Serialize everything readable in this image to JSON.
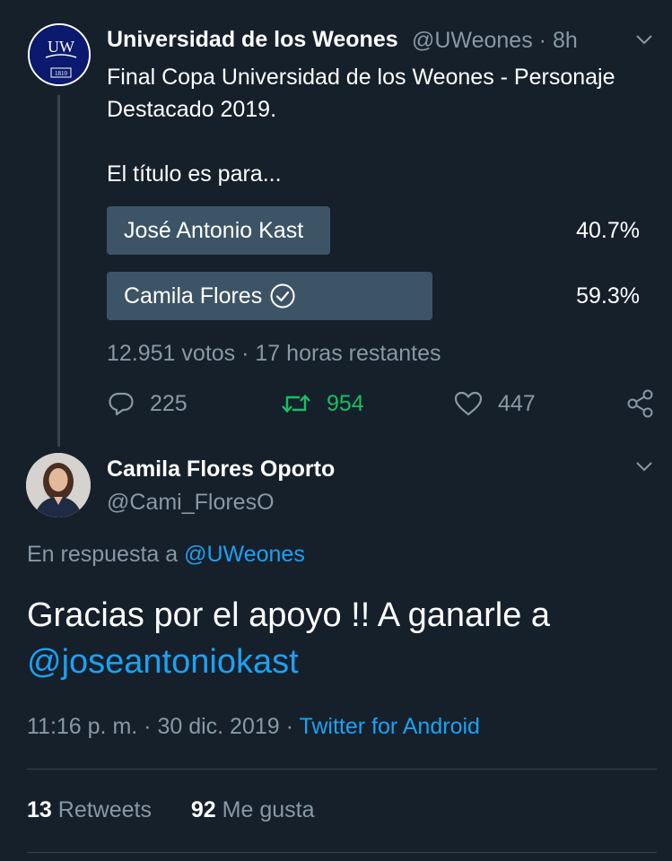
{
  "tweet1": {
    "avatar_text": "UW",
    "avatar_year": "1810",
    "name": "Universidad de los Weones",
    "handle": "@UWeones",
    "separator": "·",
    "time": "8h",
    "text_line1": "Final Copa Universidad de los Weones - Personaje Destacado 2019.",
    "text_line2": "El título es para...",
    "poll": {
      "options": [
        {
          "label": "José Antonio Kast",
          "percent": "40.7%",
          "fraction": 0.407,
          "winner": false
        },
        {
          "label": "Camila Flores",
          "percent": "59.3%",
          "fraction": 0.593,
          "winner": true
        }
      ],
      "votes": "12.951 votos",
      "remaining": "17 horas restantes"
    },
    "actions": {
      "reply_count": "225",
      "retweet_count": "954",
      "like_count": "447"
    }
  },
  "tweet2": {
    "name": "Camila Flores Oporto",
    "handle": "@Cami_FloresO",
    "reply_prefix": "En respuesta a",
    "reply_handle": "@UWeones",
    "text": "Gracias por el apoyo !! A ganarle a",
    "mention": "@joseantoniokast",
    "time": "11:16 p. m.",
    "date": "30 dic. 2019",
    "source": "Twitter for Android",
    "retweets_count": "13",
    "retweets_label": "Retweets",
    "likes_count": "92",
    "likes_label": "Me gusta"
  },
  "colors": {
    "background": "#15202b",
    "secondary_text": "#8899a6",
    "link": "#1da1f2",
    "retweet_green": "#17bf63",
    "poll_bar": "#3d5466"
  }
}
